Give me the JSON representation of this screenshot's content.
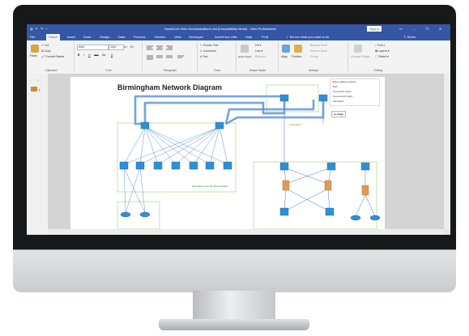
{
  "window": {
    "quick_access": "🖫 ↶ ↷ ▾",
    "title": "AssetCore Visio Demonstrations.vsd  [Compatibility Mode]  -  Visio Professional",
    "sign_in": "Sign in",
    "controls": "▭ – ❐ ✕"
  },
  "tabs": [
    {
      "label": "File"
    },
    {
      "label": "Home"
    },
    {
      "label": "Insert"
    },
    {
      "label": "Draw"
    },
    {
      "label": "Design"
    },
    {
      "label": "Data"
    },
    {
      "label": "Process"
    },
    {
      "label": "Review"
    },
    {
      "label": "View"
    },
    {
      "label": "Developer"
    },
    {
      "label": "AssetCore Utils"
    },
    {
      "label": "Help"
    },
    {
      "label": "PLM"
    }
  ],
  "tell_me": "♀ Tell me what you want to do",
  "share": "⇪ Share",
  "ribbon": {
    "clipboard": {
      "paste": "Paste",
      "cut": "✂ Cut",
      "copy": "⧉ Copy",
      "format_painter": "🖌 Format Painter",
      "label": "Clipboard"
    },
    "font": {
      "font_name": "Arial",
      "font_size": "12pt.",
      "grow": "A˄",
      "shrink": "A˅",
      "bold": "B",
      "italic": "I",
      "underline": "U",
      "strike": "abc",
      "case": "Aa",
      "color": "A",
      "label": "Font"
    },
    "paragraph": {
      "label": "Paragraph"
    },
    "tools": {
      "pointer": "↖ Pointer Tool",
      "connector": "↳ Connector",
      "text": "A Text",
      "label": "Tools"
    },
    "shape_styles": {
      "quick_styles": "Quick Styles",
      "fill": "Fill ▾",
      "line": "Line ▾",
      "effects": "Effects ▾",
      "label": "Shape Styles"
    },
    "arrange": {
      "align": "Align",
      "position": "Position",
      "bring_front": "Bring to Front",
      "send_back": "Send to Back",
      "group": "Group",
      "label": "Arrange"
    },
    "editing": {
      "change_shape": "Change Shape",
      "find": "⌕ Find ▾",
      "layers": "▤ Layers ▾",
      "select": "⬚ Select ▾",
      "label": "Editing"
    }
  },
  "diagram": {
    "title": "Birmingham Network Diagram",
    "options_title": "Select cabinet options",
    "options": [
      "Both",
      "Nexus/ACF Fabric",
      "Nexus/LACP Fabric",
      "Fabricated"
    ],
    "apply_button": "Go Stage",
    "note_green": "Data Stack is Gen 4th Server Facilities",
    "callout": "2 Link Fabric"
  },
  "colors": {
    "accent": "#3456a4",
    "link_blue": "#3b77c6",
    "link_light": "#9fc3ec",
    "group_green": "#9bd46a",
    "firewall_orange": "#e09a58",
    "switch_blue": "#2f8fd6"
  }
}
